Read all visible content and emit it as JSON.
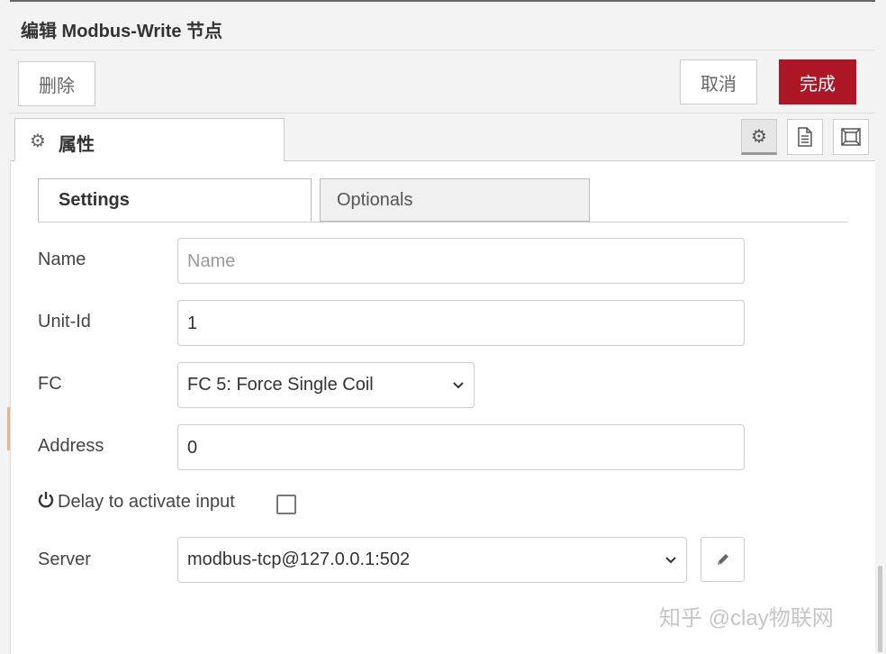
{
  "title": "编辑 Modbus-Write 节点",
  "toolbar": {
    "delete_label": "删除",
    "cancel_label": "取消",
    "done_label": "完成"
  },
  "panel_tab": {
    "label": "属性",
    "icon": "gear-icon"
  },
  "panel_icons": [
    "gear-icon",
    "document-icon",
    "frame-icon"
  ],
  "subtabs": {
    "settings": "Settings",
    "optionals": "Optionals"
  },
  "form": {
    "name": {
      "label": "Name",
      "value": "",
      "placeholder": "Name"
    },
    "unit_id": {
      "label": "Unit-Id",
      "value": "1"
    },
    "fc": {
      "label": "FC",
      "selected": "FC 5: Force Single Coil"
    },
    "address": {
      "label": "Address",
      "value": "0"
    },
    "delay": {
      "label": "Delay to activate input",
      "checked": false
    },
    "server": {
      "label": "Server",
      "selected": "modbus-tcp@127.0.0.1:502"
    }
  },
  "watermark": "知乎 @clay物联网",
  "colors": {
    "done_button": "#ad1625",
    "panel_bg": "#f3f3f3"
  }
}
